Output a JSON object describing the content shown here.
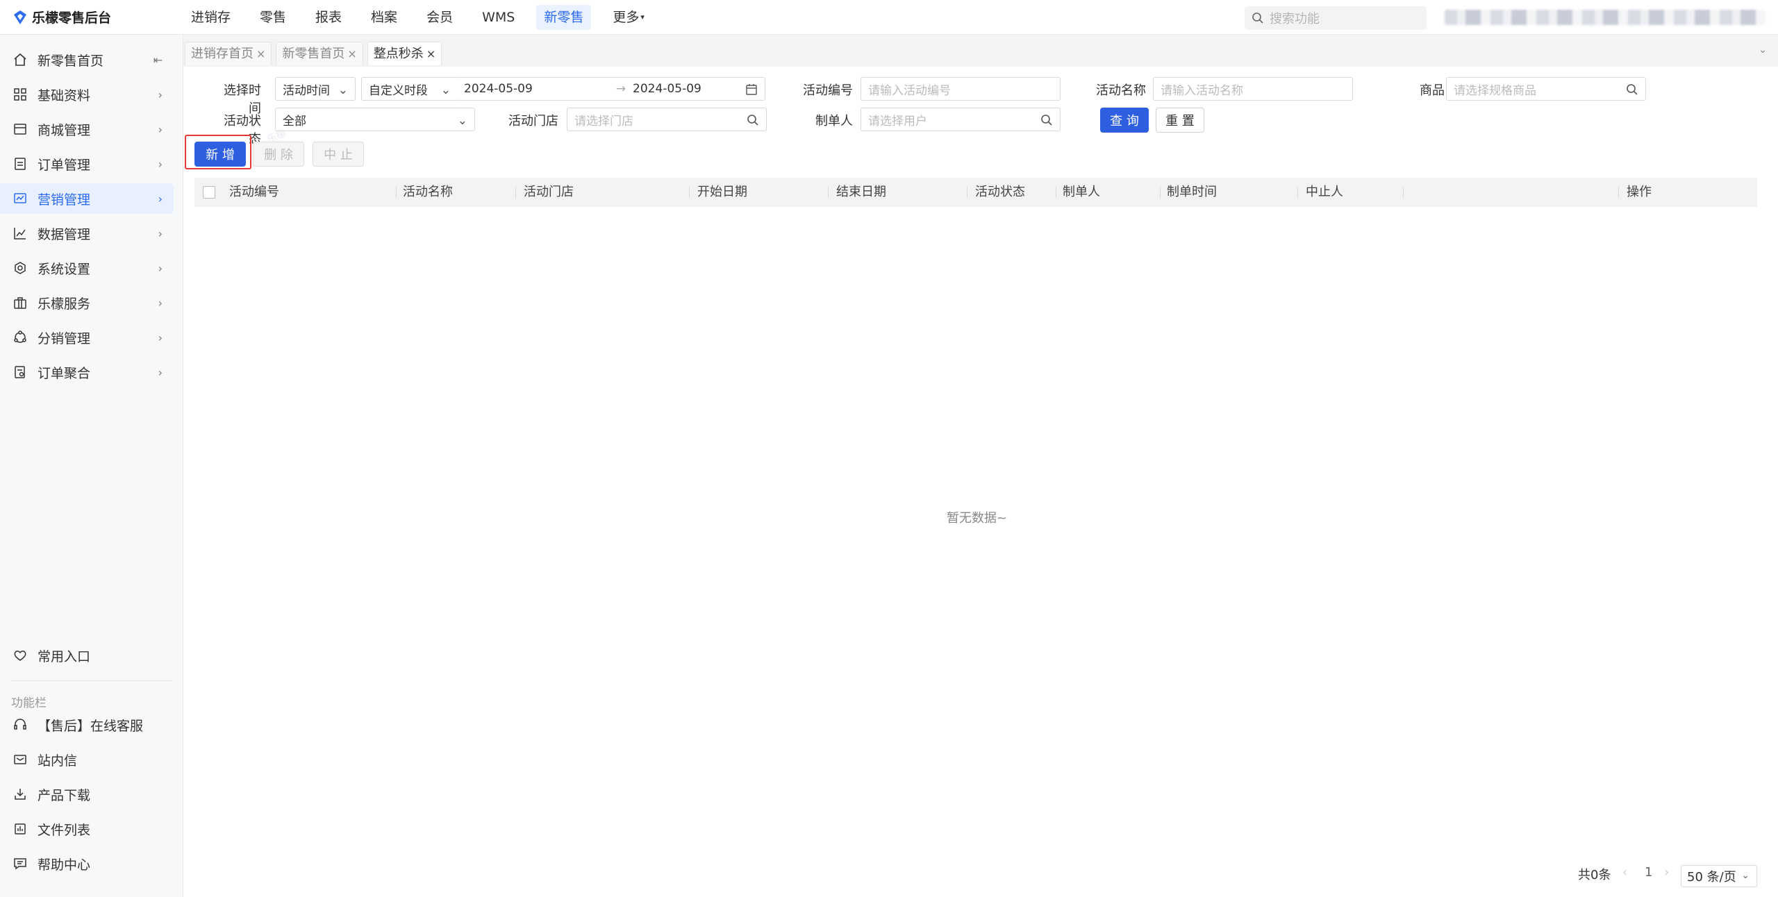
{
  "app": {
    "title": "乐檬零售后台"
  },
  "topnav": {
    "items": [
      {
        "label": "进销存"
      },
      {
        "label": "零售"
      },
      {
        "label": "报表"
      },
      {
        "label": "档案"
      },
      {
        "label": "会员"
      },
      {
        "label": "WMS"
      },
      {
        "label": "新零售",
        "active": true
      },
      {
        "label": "更多"
      }
    ],
    "search_placeholder": "搜索功能"
  },
  "sidebar": {
    "items": [
      {
        "label": "新零售首页",
        "icon": "home-icon"
      },
      {
        "label": "基础资料",
        "icon": "grid-icon"
      },
      {
        "label": "商城管理",
        "icon": "store-icon"
      },
      {
        "label": "订单管理",
        "icon": "order-icon"
      },
      {
        "label": "营销管理",
        "icon": "marketing-icon",
        "active": true
      },
      {
        "label": "数据管理",
        "icon": "chart-icon"
      },
      {
        "label": "系统设置",
        "icon": "settings-icon"
      },
      {
        "label": "乐檬服务",
        "icon": "service-icon"
      },
      {
        "label": "分销管理",
        "icon": "distribution-icon"
      },
      {
        "label": "订单聚合",
        "icon": "aggregate-icon"
      }
    ],
    "favorites_label": "常用入口",
    "section_label": "功能栏",
    "tools": [
      {
        "label": "【售后】在线客服",
        "icon": "headset-icon"
      },
      {
        "label": "站内信",
        "icon": "mail-icon"
      },
      {
        "label": "产品下载",
        "icon": "download-icon"
      },
      {
        "label": "文件列表",
        "icon": "file-list-icon"
      },
      {
        "label": "帮助中心",
        "icon": "help-icon"
      }
    ]
  },
  "tabs": [
    {
      "label": "进销存首页"
    },
    {
      "label": "新零售首页"
    },
    {
      "label": "整点秒杀",
      "active": true
    }
  ],
  "filters": {
    "time_label": "选择时间",
    "time_type": "活动时间",
    "time_range": "自定义时段",
    "date_start": "2024-05-09",
    "date_end": "2024-05-09",
    "code_label": "活动编号",
    "code_placeholder": "请输入活动编号",
    "name_label": "活动名称",
    "name_placeholder": "请输入活动名称",
    "product_label": "商品",
    "product_placeholder": "请选择规格商品",
    "status_label": "活动状态",
    "status_value": "全部",
    "store_label": "活动门店",
    "store_placeholder": "请选择门店",
    "creator_label": "制单人",
    "creator_placeholder": "请选择用户",
    "query_button": "查 询",
    "reset_button": "重 置"
  },
  "actions": {
    "add": "新 增",
    "delete": "删 除",
    "stop": "中 止"
  },
  "table": {
    "columns": [
      "活动编号",
      "活动名称",
      "活动门店",
      "开始日期",
      "结束日期",
      "活动状态",
      "制单人",
      "制单时间",
      "中止人",
      "",
      "操作"
    ],
    "empty_text": "暂无数据~"
  },
  "pagination": {
    "total": "共0条",
    "page": "1",
    "page_size": "50 条/页"
  },
  "colors": {
    "primary": "#2d5fe0",
    "active_nav_bg": "#eaf1ff",
    "highlight": "#e53935"
  }
}
